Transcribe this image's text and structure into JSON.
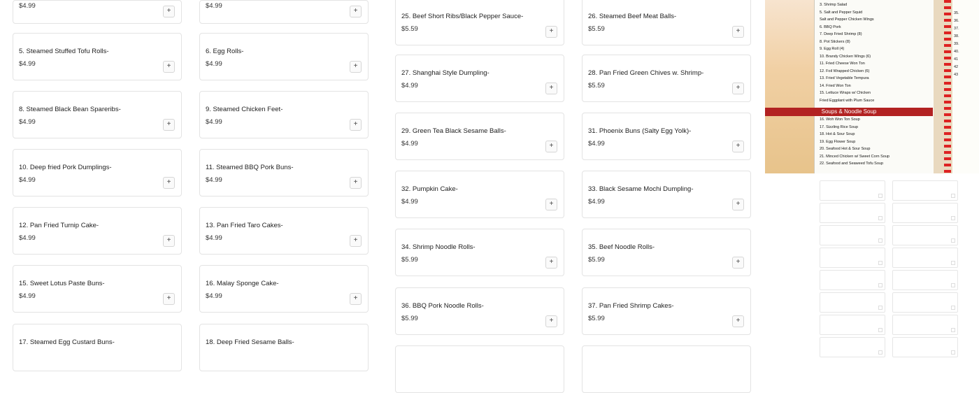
{
  "menu_items": [
    {
      "col": 0,
      "name": "",
      "price": "$4.99",
      "partial": true
    },
    {
      "col": 1,
      "name": "",
      "price": "$4.99",
      "partial": true
    },
    {
      "col": 0,
      "name": "5. Steamed Stuffed Tofu Rolls-",
      "price": "$4.99"
    },
    {
      "col": 1,
      "name": "6. Egg Rolls-",
      "price": "$4.99"
    },
    {
      "col": 0,
      "name": "8. Steamed Black Bean Spareribs-",
      "price": "$4.99"
    },
    {
      "col": 1,
      "name": "9. Steamed Chicken Feet-",
      "price": "$4.99"
    },
    {
      "col": 0,
      "name": "10. Deep fried Pork Dumplings-",
      "price": "$4.99"
    },
    {
      "col": 1,
      "name": "11. Steamed BBQ Pork Buns-",
      "price": "$4.99"
    },
    {
      "col": 0,
      "name": "12. Pan Fried Turnip Cake-",
      "price": "$4.99"
    },
    {
      "col": 1,
      "name": "13. Pan Fried Taro Cakes-",
      "price": "$4.99"
    },
    {
      "col": 0,
      "name": "15. Sweet Lotus Paste Buns-",
      "price": "$4.99"
    },
    {
      "col": 1,
      "name": "16. Malay Sponge Cake-",
      "price": "$4.99"
    },
    {
      "col": 0,
      "name": "17. Steamed Egg Custard Buns-",
      "price": ""
    },
    {
      "col": 1,
      "name": "18. Deep Fried Sesame Balls-",
      "price": ""
    }
  ],
  "menu_items_right": [
    {
      "col": 2,
      "name": "25. Beef Short Ribs/Black Pepper Sauce-",
      "price": "$5.59"
    },
    {
      "col": 3,
      "name": "26. Steamed Beef Meat Balls-",
      "price": "$5.59"
    },
    {
      "col": 2,
      "name": "27. Shanghai Style Dumpling-",
      "price": "$4.99"
    },
    {
      "col": 3,
      "name": "28. Pan Fried Green Chives w. Shrimp-",
      "price": "$5.59"
    },
    {
      "col": 2,
      "name": "29. Green Tea Black Sesame Balls-",
      "price": "$4.99"
    },
    {
      "col": 3,
      "name": "31. Phoenix Buns (Salty Egg Yolk)-",
      "price": "$4.99"
    },
    {
      "col": 2,
      "name": "32. Pumpkin Cake-",
      "price": "$4.99"
    },
    {
      "col": 3,
      "name": "33. Black Sesame Mochi Dumpling-",
      "price": "$4.99"
    },
    {
      "col": 2,
      "name": "34. Shrimp Noodle Rolls-",
      "price": "$5.99"
    },
    {
      "col": 3,
      "name": "35. Beef Noodle Rolls-",
      "price": "$5.99"
    },
    {
      "col": 2,
      "name": "36. BBQ Pork Noodle Rolls-",
      "price": "$5.99"
    },
    {
      "col": 3,
      "name": "37. Pan Fried Shrimp Cakes-",
      "price": "$5.99"
    }
  ],
  "add_icon": "+",
  "menu_photo": {
    "banner": "Soups & Noodle Soup",
    "lines": [
      "3. Shrimp Salad",
      "5. Salt and Pepper Squid",
      "Salt and Pepper Chicken Wings",
      "6. BBQ Pork",
      "7. Deep Fried Shrimp (8)",
      "8. Pot Stickers (8)",
      "9. Egg Roll (4)",
      "10. Brandy Chicken Wings (6)",
      "11. Fried Cheese Won Ton",
      "12. Foil Wrapped Chicken (6)",
      "13. Fried Vegetable Tempura",
      "14. Fried Won Ton",
      "15. Lettuce Wraps w/ Chicken",
      "Fried Eggplant with Plum Sauce",
      "16. Woh Won Ton Soup",
      "17. Sizzling Rice Soup",
      "18. Hot & Sour Soup",
      "19. Egg Flower Soup",
      "20. Seafood Hot & Sour Soup",
      "21. Minced Chicken w/ Sweet Corn Soup",
      "22. Seafood and Seaweed Tofu Soup"
    ],
    "right_numbers": [
      "35.",
      "36.",
      "37.",
      "38.",
      "39.",
      "40.",
      "41",
      "42",
      "43"
    ]
  }
}
